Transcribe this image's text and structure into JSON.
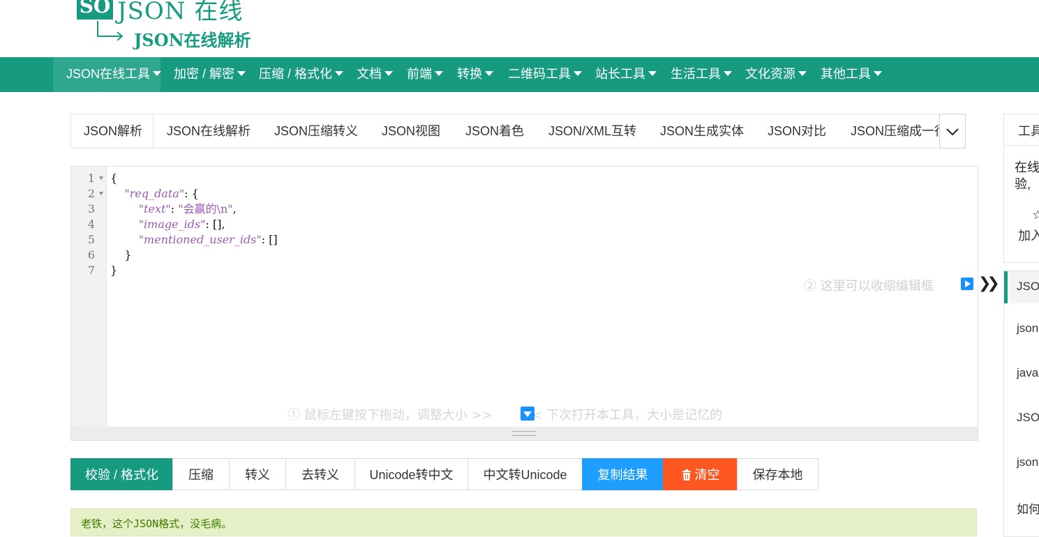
{
  "logo": {
    "badge": "SO",
    "title": "JSON 在线",
    "subtitle": "JSON在线解析"
  },
  "nav": {
    "items": [
      {
        "label": "JSON在线工具",
        "active": true
      },
      {
        "label": "加密 / 解密"
      },
      {
        "label": "压缩 / 格式化"
      },
      {
        "label": "文档"
      },
      {
        "label": "前端"
      },
      {
        "label": "转换"
      },
      {
        "label": "二维码工具"
      },
      {
        "label": "站长工具"
      },
      {
        "label": "生活工具"
      },
      {
        "label": "文化资源"
      },
      {
        "label": "其他工具"
      }
    ]
  },
  "tabs": {
    "items": [
      "JSON解析",
      "JSON在线解析",
      "JSON压缩转义",
      "JSON视图",
      "JSON着色",
      "JSON/XML互转",
      "JSON生成实体",
      "JSON对比",
      "JSON压缩成一行"
    ],
    "more_icon": "chevron-down-icon"
  },
  "editor": {
    "line_numbers": [
      "1",
      "2",
      "3",
      "4",
      "5",
      "6",
      "7"
    ],
    "lines": [
      [
        {
          "t": "p",
          "v": "{"
        }
      ],
      [
        {
          "t": "p",
          "v": "    "
        },
        {
          "t": "k",
          "v": "\"req_data\""
        },
        {
          "t": "p",
          "v": ": {"
        }
      ],
      [
        {
          "t": "p",
          "v": "        "
        },
        {
          "t": "k",
          "v": "\"text\""
        },
        {
          "t": "p",
          "v": ": "
        },
        {
          "t": "s",
          "v": "\"会赢的\\n\""
        },
        {
          "t": "p",
          "v": ","
        }
      ],
      [
        {
          "t": "p",
          "v": "        "
        },
        {
          "t": "k",
          "v": "\"image_ids\""
        },
        {
          "t": "p",
          "v": ": [],"
        }
      ],
      [
        {
          "t": "p",
          "v": "        "
        },
        {
          "t": "k",
          "v": "\"mentioned_user_ids\""
        },
        {
          "t": "p",
          "v": ": []"
        }
      ],
      [
        {
          "t": "p",
          "v": "    }"
        }
      ],
      [
        {
          "t": "p",
          "v": "}"
        }
      ]
    ],
    "collapse_hint": "② 这里可以收缩编辑框",
    "resize_hint_left": "① 鼠标左键按下拖动，调整大小 >>",
    "resize_hint_right": "<< 下次打开本工具，大小是记忆的"
  },
  "actions": {
    "validate": "校验 / 格式化",
    "compress": "压缩",
    "escape": "转义",
    "unescape": "去转义",
    "unicode_to_cn": "Unicode转中文",
    "cn_to_unicode": "中文转Unicode",
    "copy": "复制结果",
    "clear": "清空",
    "save": "保存本地"
  },
  "result": {
    "message": "老铁，这个JSON格式，没毛病。"
  },
  "side": {
    "card_title": "工具",
    "card_desc": "在线\n验,",
    "fav_label": "加入",
    "list": [
      "JSO",
      "json",
      "java",
      "JSO",
      "json",
      "如何"
    ]
  }
}
